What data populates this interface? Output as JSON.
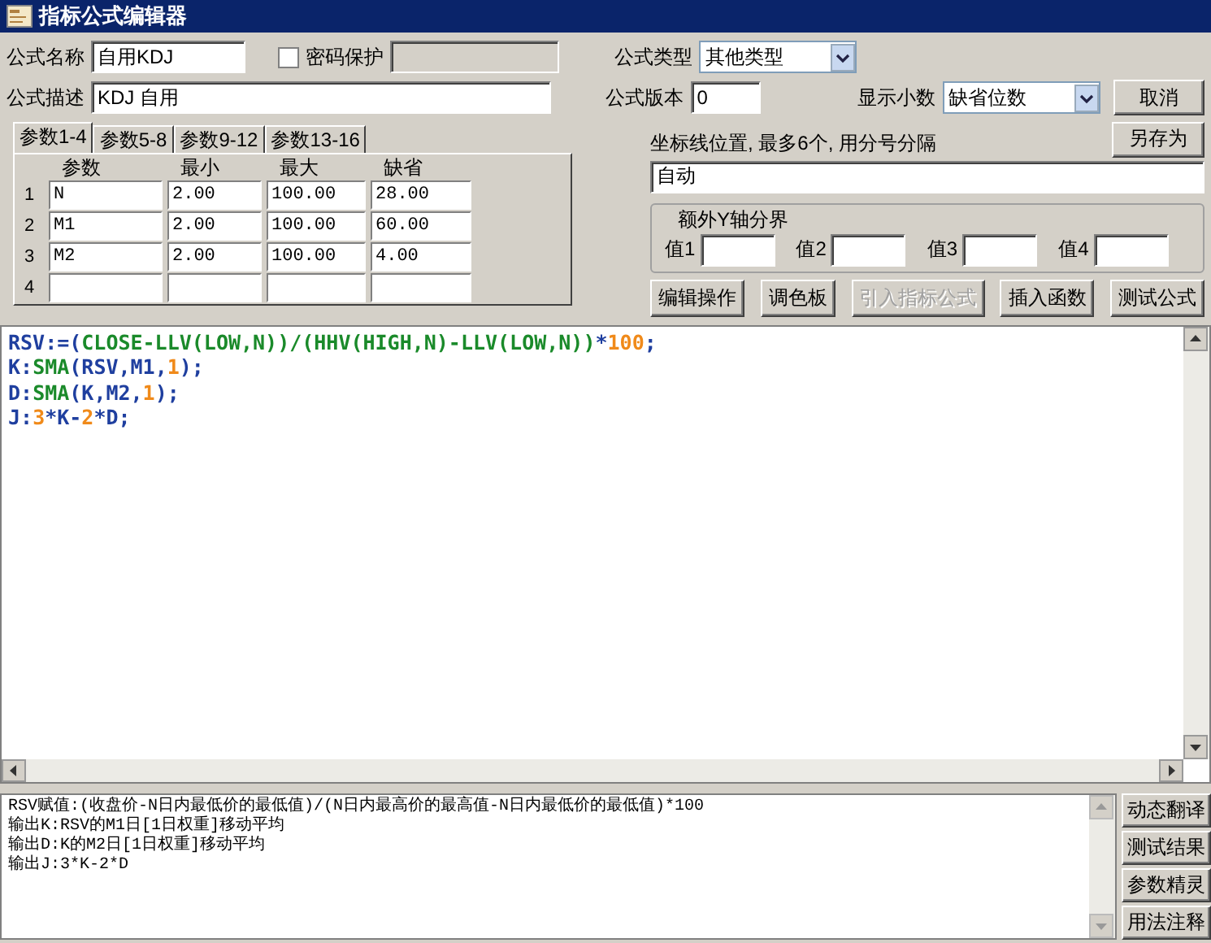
{
  "window": {
    "title": "指标公式编辑器"
  },
  "name_field": {
    "label": "公式名称",
    "value": "自用KDJ"
  },
  "password": {
    "label": "密码保护",
    "checked": false
  },
  "type_field": {
    "label": "公式类型",
    "value": "其他类型"
  },
  "description_field": {
    "label": "公式描述",
    "value": "KDJ 自用"
  },
  "version_field": {
    "label": "公式版本",
    "value": "0"
  },
  "decimals_field": {
    "label": "显示小数",
    "value": "缺省位数"
  },
  "cancel_button": "取消",
  "save_as_button": "另存为",
  "param_tabs": [
    {
      "label": "参数1-4",
      "selected": true
    },
    {
      "label": "参数5-8",
      "selected": false
    },
    {
      "label": "参数9-12",
      "selected": false
    },
    {
      "label": "参数13-16",
      "selected": false
    }
  ],
  "param_table": {
    "columns": [
      "参数",
      "最小",
      "最大",
      "缺省"
    ],
    "rows": [
      {
        "index": "1",
        "cells": [
          "N",
          "2.00",
          "100.00",
          "28.00"
        ]
      },
      {
        "index": "2",
        "cells": [
          "M1",
          "2.00",
          "100.00",
          "60.00"
        ]
      },
      {
        "index": "3",
        "cells": [
          "M2",
          "2.00",
          "100.00",
          "4.00"
        ]
      },
      {
        "index": "4"
      }
    ]
  },
  "axis_lines": {
    "label": "坐标线位置, 最多6个, 用分号分隔",
    "value": "自动"
  },
  "y_boundaries": {
    "title": "额外Y轴分界",
    "fields": [
      "值1",
      "值2",
      "值3",
      "值4"
    ]
  },
  "tool_buttons": [
    {
      "label": "编辑操作",
      "disabled": false
    },
    {
      "label": "调色板",
      "disabled": false
    },
    {
      "label": "引入指标公式",
      "disabled": true
    },
    {
      "label": "插入函数",
      "disabled": false
    },
    {
      "label": "测试公式",
      "disabled": false
    }
  ],
  "code_lines": [
    [
      {
        "text": "RSV:=(",
        "kind": "name"
      },
      {
        "text": "CLOSE-LLV(LOW,N))/(HHV(HIGH,N)-LLV(LOW,N))",
        "kind": "func"
      },
      {
        "text": "*",
        "kind": "name"
      },
      {
        "text": "100",
        "kind": "number"
      },
      {
        "text": ";",
        "kind": "name"
      }
    ],
    [
      {
        "text": "K:",
        "kind": "name"
      },
      {
        "text": "SMA",
        "kind": "func"
      },
      {
        "text": "(RSV,M1,",
        "kind": "name"
      },
      {
        "text": "1",
        "kind": "number"
      },
      {
        "text": ");",
        "kind": "name"
      }
    ],
    [
      {
        "text": "D:",
        "kind": "name"
      },
      {
        "text": "SMA",
        "kind": "func"
      },
      {
        "text": "(K,M2,",
        "kind": "name"
      },
      {
        "text": "1",
        "kind": "number"
      },
      {
        "text": ");",
        "kind": "name"
      }
    ],
    [
      {
        "text": "J:",
        "kind": "name"
      },
      {
        "text": "3",
        "kind": "number"
      },
      {
        "text": "*K-",
        "kind": "name"
      },
      {
        "text": "2",
        "kind": "number"
      },
      {
        "text": "*D;",
        "kind": "name"
      }
    ]
  ],
  "translation_lines": [
    "RSV赋值:(收盘价-N日内最低价的最低值)/(N日内最高价的最高值-N日内最低价的最低值)*100",
    "输出K:RSV的M1日[1日权重]移动平均",
    "输出D:K的M2日[1日权重]移动平均",
    "输出J:3*K-2*D"
  ],
  "side_buttons": [
    "动态翻译",
    "测试结果",
    "参数精灵",
    "用法注释"
  ]
}
